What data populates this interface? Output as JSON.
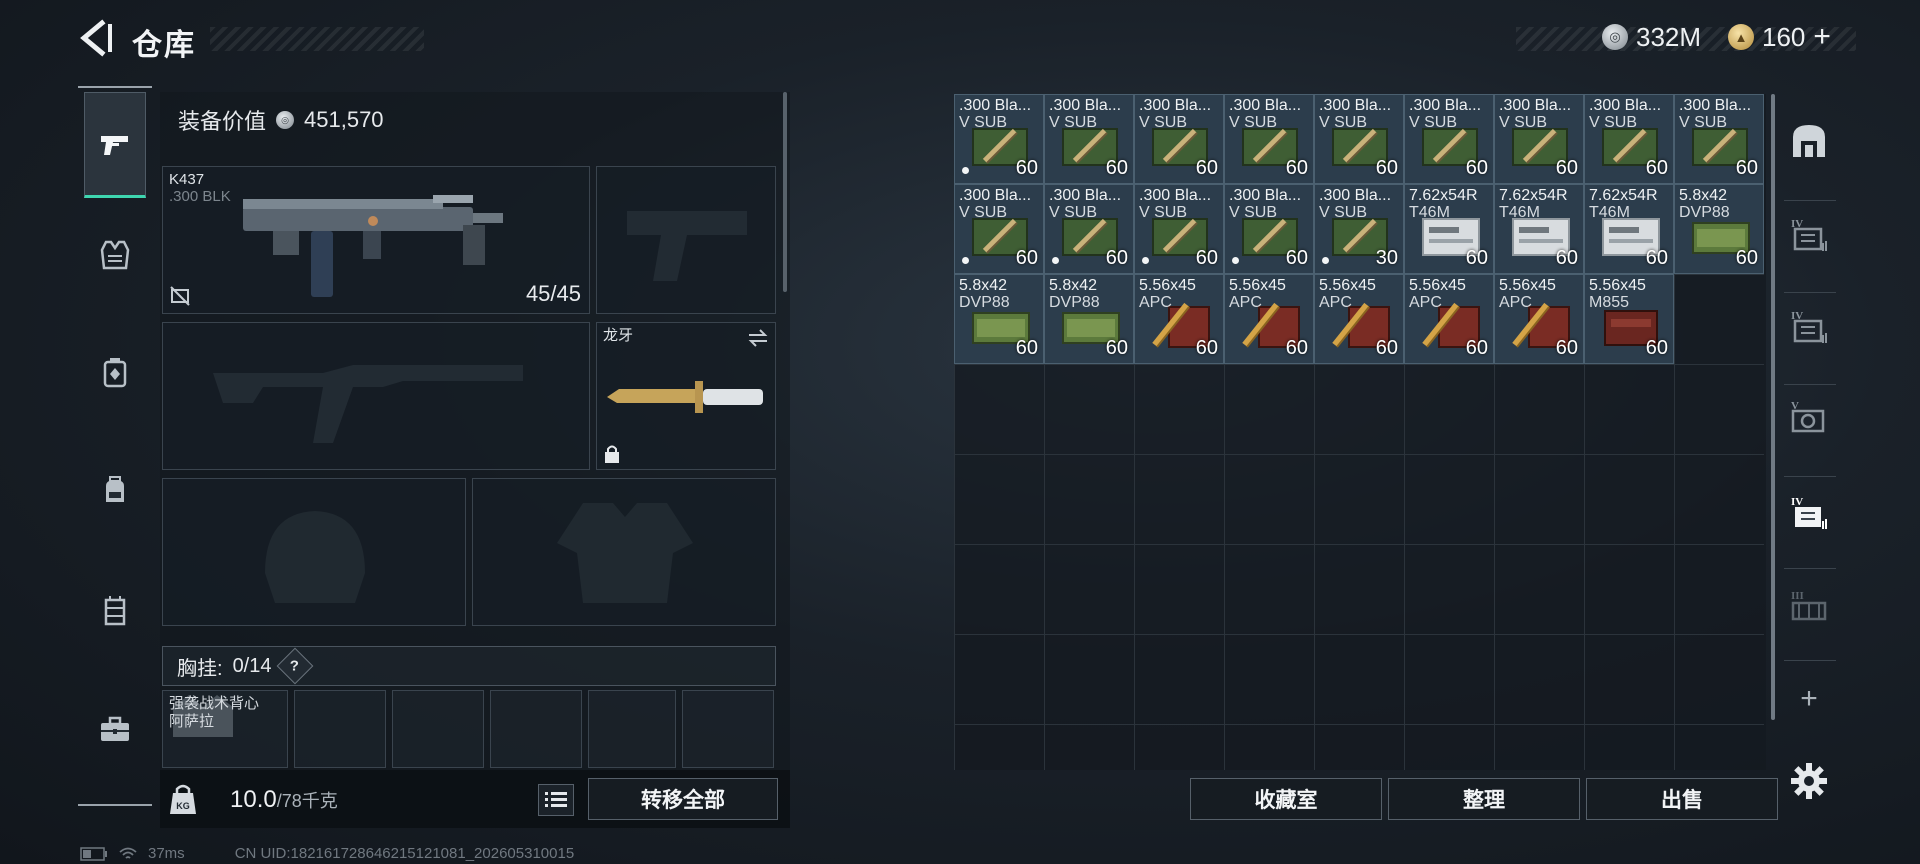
{
  "header": {
    "title": "仓库",
    "currencies": [
      {
        "icon": "silver-coin-icon",
        "value": "332M"
      },
      {
        "icon": "gold-coin-icon",
        "value": "160",
        "plus": "+"
      }
    ]
  },
  "left_rail": {
    "items": [
      {
        "icon": "pistol-icon",
        "active": true
      },
      {
        "icon": "vest-icon",
        "active": false
      },
      {
        "icon": "armor-plate-icon",
        "active": false
      },
      {
        "icon": "backpack-icon",
        "active": false
      },
      {
        "icon": "rig-icon",
        "active": false
      },
      {
        "icon": "toolbox-icon",
        "active": false
      }
    ]
  },
  "equipment": {
    "value_label": "装备价值",
    "value": "451,570",
    "primary_weapon": {
      "name": "K437",
      "caliber": ".300 BLK",
      "ammo": "45/45"
    },
    "melee": {
      "name": "龙牙"
    },
    "chest_rig": {
      "label": "胸挂:",
      "count": "0/14",
      "help": "?"
    },
    "rig_item": {
      "name_line1": "强袭战术背心",
      "name_line2": "阿萨拉"
    },
    "weight": {
      "current": "10.0",
      "max": "/78千克"
    },
    "transfer_all": "转移全部"
  },
  "storage": {
    "items": [
      {
        "name": ".300 Bla...",
        "sub": "V SUB",
        "count": "60",
        "type": "green",
        "dot": true
      },
      {
        "name": ".300 Bla...",
        "sub": "V SUB",
        "count": "60",
        "type": "green",
        "dot": false
      },
      {
        "name": ".300 Bla...",
        "sub": "V SUB",
        "count": "60",
        "type": "green",
        "dot": false
      },
      {
        "name": ".300 Bla...",
        "sub": "V SUB",
        "count": "60",
        "type": "green",
        "dot": false
      },
      {
        "name": ".300 Bla...",
        "sub": "V SUB",
        "count": "60",
        "type": "green",
        "dot": false
      },
      {
        "name": ".300 Bla...",
        "sub": "V SUB",
        "count": "60",
        "type": "green",
        "dot": false
      },
      {
        "name": ".300 Bla...",
        "sub": "V SUB",
        "count": "60",
        "type": "green",
        "dot": false
      },
      {
        "name": ".300 Bla...",
        "sub": "V SUB",
        "count": "60",
        "type": "green",
        "dot": false
      },
      {
        "name": ".300 Bla...",
        "sub": "V SUB",
        "count": "60",
        "type": "green",
        "dot": false
      },
      {
        "name": ".300 Bla...",
        "sub": "V SUB",
        "count": "60",
        "type": "green",
        "dot": true
      },
      {
        "name": ".300 Bla...",
        "sub": "V SUB",
        "count": "60",
        "type": "green",
        "dot": true
      },
      {
        "name": ".300 Bla...",
        "sub": "V SUB",
        "count": "60",
        "type": "green",
        "dot": true
      },
      {
        "name": ".300 Bla...",
        "sub": "V SUB",
        "count": "60",
        "type": "green",
        "dot": true
      },
      {
        "name": ".300 Bla...",
        "sub": "V SUB",
        "count": "30",
        "type": "green",
        "dot": true
      },
      {
        "name": "7.62x54R",
        "sub": "T46M",
        "count": "60",
        "type": "white",
        "dot": false
      },
      {
        "name": "7.62x54R",
        "sub": "T46M",
        "count": "60",
        "type": "white",
        "dot": false
      },
      {
        "name": "7.62x54R",
        "sub": "T46M",
        "count": "60",
        "type": "white",
        "dot": false
      },
      {
        "name": "5.8x42",
        "sub": "DVP88",
        "count": "60",
        "type": "olive",
        "dot": false
      },
      {
        "name": "5.8x42",
        "sub": "DVP88",
        "count": "60",
        "type": "olive",
        "dot": false
      },
      {
        "name": "5.8x42",
        "sub": "DVP88",
        "count": "60",
        "type": "olive",
        "dot": false
      },
      {
        "name": "5.56x45",
        "sub": "APC",
        "count": "60",
        "type": "red",
        "dot": false
      },
      {
        "name": "5.56x45",
        "sub": "APC",
        "count": "60",
        "type": "red",
        "dot": false
      },
      {
        "name": "5.56x45",
        "sub": "APC",
        "count": "60",
        "type": "red",
        "dot": false
      },
      {
        "name": "5.56x45",
        "sub": "APC",
        "count": "60",
        "type": "red",
        "dot": false
      },
      {
        "name": "5.56x45",
        "sub": "APC",
        "count": "60",
        "type": "red",
        "dot": false
      },
      {
        "name": "5.56x45",
        "sub": "M855",
        "count": "60",
        "type": "darkred",
        "dot": false
      }
    ],
    "buttons": {
      "collection": "收藏室",
      "sort": "整理",
      "sell": "出售"
    }
  },
  "side_rail": {
    "items": [
      {
        "icon": "vault-icon",
        "label": ""
      },
      {
        "icon": "container-iv-icon",
        "label": "IV"
      },
      {
        "icon": "container-iv-icon",
        "label": "IV"
      },
      {
        "icon": "container-v-icon",
        "label": "V"
      },
      {
        "icon": "container-iv-active-icon",
        "label": "IV"
      },
      {
        "icon": "container-iii-icon",
        "label": "III"
      }
    ],
    "add": "+"
  },
  "footer": {
    "ping": "37ms",
    "uid": "CN UID:18216172864621512108​1_202605310015"
  },
  "colors": {
    "accent": "#3ed6b0",
    "cell_bg": "#2c3d4c",
    "button_border": "#56606a"
  }
}
